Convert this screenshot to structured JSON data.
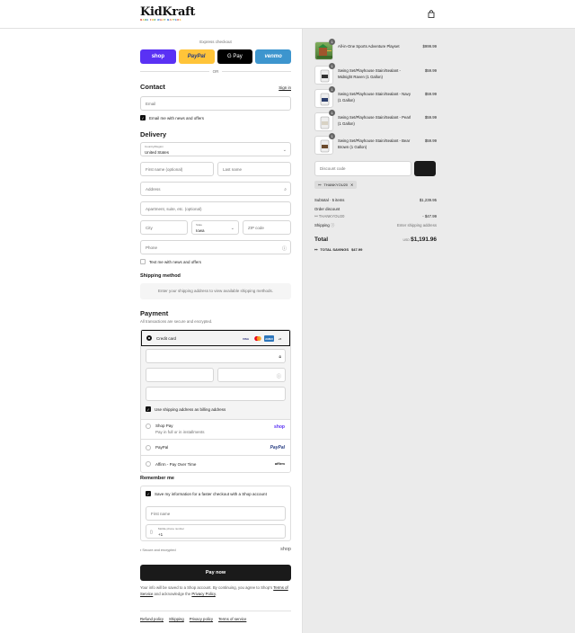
{
  "header": {
    "logo_word": "KidKraft",
    "logo_tag": "MADE FOR WHAT MATTERS",
    "cart_icon": "bag-icon"
  },
  "express": {
    "label": "Express checkout",
    "shop": "shop",
    "paypal": "PayPal",
    "gpay": "G Pay",
    "venmo": "venmo",
    "or": "OR"
  },
  "contact": {
    "title": "Contact",
    "signin": "Sign in",
    "email_placeholder": "Email",
    "newsletter": "Email me with news and offers"
  },
  "delivery": {
    "title": "Delivery",
    "country_label": "Country/Region",
    "country_value": "United States",
    "first_name": "First name (optional)",
    "last_name": "Last name",
    "address": "Address",
    "apartment": "Apartment, suite, etc. (optional)",
    "city": "City",
    "state_label": "State",
    "state_value": "Iowa",
    "zip": "ZIP code",
    "phone": "Phone",
    "text_me": "Text me with news and offers"
  },
  "shipping": {
    "title": "Shipping method",
    "message": "Enter your shipping address to view available shipping methods."
  },
  "payment": {
    "title": "Payment",
    "subtitle": "All transactions are secure and encrypted.",
    "credit_card": "Credit card",
    "billing_same": "Use shipping address as billing address",
    "shop_pay": "Shop Pay",
    "shop_pay_sub": "Pay in full or in installments",
    "shop_pay_logo": "shop",
    "paypal": "PayPal",
    "paypal_logo": "PayPal",
    "affirm": "Affirm - Pay Over Time",
    "affirm_logo": "affirm",
    "card_visa": "VISA",
    "card_amex": "AMEX",
    "card_more": "+5"
  },
  "remember": {
    "title": "Remember me",
    "save": "Save my information for a faster checkout with a Shop account",
    "first_name": "First name",
    "mobile_label": "Mobile phone number",
    "mobile_value": "+1",
    "secure": "Secure and encrypted",
    "shop_logo": "shop"
  },
  "paynow": "Pay now",
  "legal": {
    "prefix": "Your info will be saved to a Shop account. By continuing, you agree to Shop's",
    "terms": "Terms of Service",
    "middle": "and acknowledge the",
    "privacy": "Privacy Policy",
    "suffix": "."
  },
  "footer": [
    "Refund policy",
    "Shipping",
    "Privacy policy",
    "Terms of service"
  ],
  "cart": {
    "items": [
      {
        "name": "All-in-One Sports Adventure Playset",
        "price": "$999.99",
        "qty": "1"
      },
      {
        "name": "Swing Set/Playhouse Stain/Sealant - Midnight Raven (1 Gallon)",
        "price": "$59.99",
        "qty": "1"
      },
      {
        "name": "Swing Set/Playhouse Stain/Sealant - Navy (1 Gallon)",
        "price": "$59.99",
        "qty": "1"
      },
      {
        "name": "Swing Set/Playhouse Stain/Sealant - Pearl (1 Gallon)",
        "price": "$59.99",
        "qty": "1"
      },
      {
        "name": "Swing Set/Playhouse Stain/Sealant - Bear Brown (1 Gallon)",
        "price": "$59.99",
        "qty": "1"
      }
    ],
    "discount_placeholder": "Discount code",
    "discount_tag": "THANKYOU20",
    "subtotal_label": "Subtotal · 5 items",
    "subtotal_value": "$1,239.95",
    "order_discount": "Order discount",
    "discount_code": "THANKYOU20",
    "discount_value": "- $47.99",
    "shipping_label": "Shipping",
    "shipping_value": "Enter shipping address",
    "total_label": "Total",
    "currency": "USD",
    "total_value": "$1,191.96",
    "savings_label": "TOTAL SAVINGS",
    "savings_value": "$47.99"
  },
  "colors": {
    "shop": "#5a31f4",
    "paypal": "#ffc439",
    "venmo": "#3d95ce",
    "dark": "#1a1a1a"
  }
}
